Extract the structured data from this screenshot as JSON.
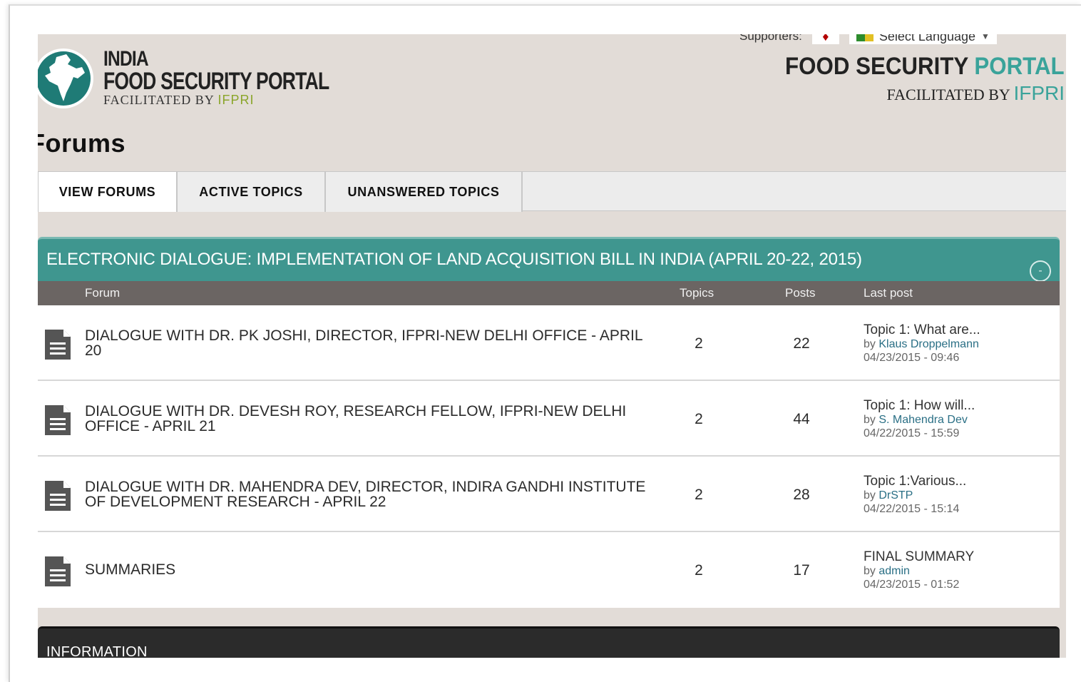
{
  "header": {
    "logo_left": {
      "line1": "INDIA",
      "line2": "FOOD SECURITY PORTAL",
      "facilitated": "FACILITATED BY",
      "ifpri": "IFPRI"
    },
    "supporters_label": "Supporters:",
    "language_select": "Select Language",
    "language_caret": "▼",
    "logo_right": {
      "title_part1": "FOOD SECURITY ",
      "title_part2": "PORTAL",
      "facilitated": "FACILITATED BY ",
      "ifpri": "IFPRI"
    },
    "accent_color": "#3f968f"
  },
  "page_title": "Forums",
  "tabs": [
    {
      "label": "VIEW FORUMS",
      "active": true
    },
    {
      "label": "ACTIVE TOPICS",
      "active": false
    },
    {
      "label": "UNANSWERED TOPICS",
      "active": false
    }
  ],
  "forum_group": {
    "title": "ELECTRONIC DIALOGUE: IMPLEMENTATION OF LAND ACQUISITION BILL IN INDIA (APRIL 20-22, 2015)",
    "collapse_symbol": "-",
    "columns": {
      "forum": "Forum",
      "topics": "Topics",
      "posts": "Posts",
      "last_post": "Last post"
    },
    "rows": [
      {
        "name": "DIALOGUE WITH DR. PK JOSHI, DIRECTOR, IFPRI-NEW DELHI OFFICE - APRIL 20",
        "topics": "2",
        "posts": "22",
        "last_title": "Topic 1: What are...",
        "last_by": "by ",
        "last_author": "Klaus Droppelmann",
        "last_date": "04/23/2015 - 09:46"
      },
      {
        "name": "DIALOGUE WITH DR. DEVESH ROY, RESEARCH FELLOW, IFPRI-NEW DELHI OFFICE - APRIL 21",
        "topics": "2",
        "posts": "44",
        "last_title": "Topic 1: How will...",
        "last_by": "by ",
        "last_author": "S. Mahendra Dev",
        "last_date": "04/22/2015 - 15:59"
      },
      {
        "name": "DIALOGUE WITH DR. MAHENDRA DEV, DIRECTOR, INDIRA GANDHI INSTITUTE OF DEVELOPMENT RESEARCH - APRIL 22",
        "topics": "2",
        "posts": "28",
        "last_title": "Topic 1:Various...",
        "last_by": "by ",
        "last_author": "DrSTP",
        "last_date": "04/22/2015 - 15:14"
      },
      {
        "name": "SUMMARIES",
        "topics": "2",
        "posts": "17",
        "last_title": "FINAL SUMMARY",
        "last_by": "by ",
        "last_author": "admin",
        "last_date": "04/23/2015 - 01:52"
      }
    ]
  },
  "info_section": {
    "title": "INFORMATION"
  },
  "icons": {
    "logo": "india-map-icon",
    "forum_row": "document-icon",
    "collapse": "collapse-circle-icon",
    "supporter": "supporter-logo-icon",
    "language": "google-translate-icon"
  }
}
